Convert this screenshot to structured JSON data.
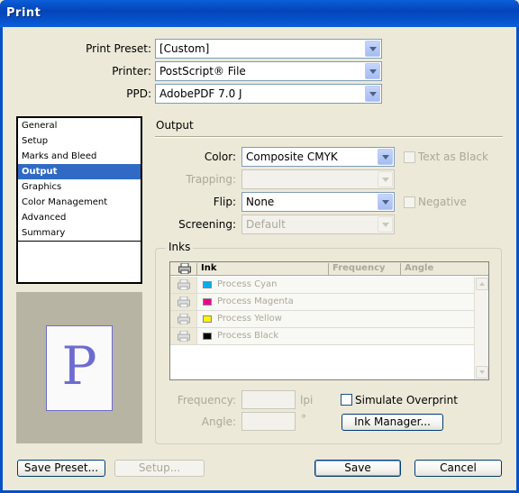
{
  "window": {
    "title": "Print"
  },
  "top_fields": {
    "preset": {
      "label": "Print Preset:",
      "value": "[Custom]"
    },
    "printer": {
      "label": "Printer:",
      "value": "PostScript® File"
    },
    "ppd": {
      "label": "PPD:",
      "value": "AdobePDF 7.0 J"
    }
  },
  "categories": [
    "General",
    "Setup",
    "Marks and Bleed",
    "Output",
    "Graphics",
    "Color Management",
    "Advanced",
    "Summary"
  ],
  "selected_category": "Output",
  "preview": {
    "glyph": "P"
  },
  "output": {
    "title": "Output",
    "color": {
      "label": "Color:",
      "value": "Composite CMYK"
    },
    "text_as_black": {
      "label": "Text as Black",
      "checked": false,
      "enabled": false
    },
    "trapping": {
      "label": "Trapping:",
      "value": "",
      "enabled": false
    },
    "flip": {
      "label": "Flip:",
      "value": "None"
    },
    "negative": {
      "label": "Negative",
      "checked": false,
      "enabled": false
    },
    "screening": {
      "label": "Screening:",
      "value": "Default",
      "enabled": false
    }
  },
  "inks": {
    "title": "Inks",
    "columns": [
      "Ink",
      "Frequency",
      "Angle"
    ],
    "rows": [
      {
        "name": "Process Cyan",
        "color": "#00aeef"
      },
      {
        "name": "Process Magenta",
        "color": "#ec008c"
      },
      {
        "name": "Process Yellow",
        "color": "#fff200"
      },
      {
        "name": "Process Black",
        "color": "#000000"
      }
    ],
    "frequency": {
      "label": "Frequency:",
      "unit": "lpi"
    },
    "angle": {
      "label": "Angle:",
      "unit": "°"
    },
    "simulate_overprint": {
      "label": "Simulate Overprint",
      "checked": false
    },
    "ink_manager_label": "Ink Manager..."
  },
  "buttons": {
    "save_preset": "Save Preset...",
    "setup": "Setup...",
    "save": "Save",
    "cancel": "Cancel"
  }
}
